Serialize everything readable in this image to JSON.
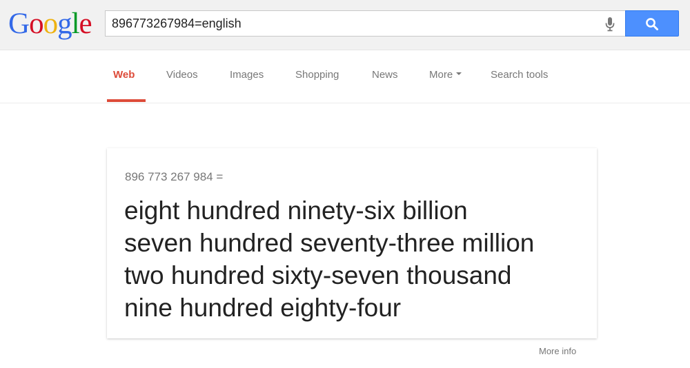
{
  "logo": {
    "letters": [
      {
        "char": "G",
        "color": "#3369e8"
      },
      {
        "char": "o",
        "color": "#d50f25"
      },
      {
        "char": "o",
        "color": "#eeb211"
      },
      {
        "char": "g",
        "color": "#3369e8"
      },
      {
        "char": "l",
        "color": "#009925"
      },
      {
        "char": "e",
        "color": "#d50f25"
      }
    ]
  },
  "search": {
    "query": "896773267984=english",
    "mic_icon": "microphone-icon",
    "button_icon": "magnifier-icon"
  },
  "nav": {
    "tabs": [
      {
        "label": "Web",
        "active": true
      },
      {
        "label": "Videos"
      },
      {
        "label": "Images"
      },
      {
        "label": "Shopping"
      },
      {
        "label": "News"
      },
      {
        "label": "More"
      },
      {
        "label": "Search tools"
      }
    ],
    "active_color": "#dd4b39"
  },
  "result": {
    "expression": "896 773 267 984 =",
    "lines": [
      "eight hundred ninety-six billion",
      "seven hundred seventy-three million",
      "two hundred sixty-seven thousand",
      "nine hundred eighty-four"
    ]
  },
  "footer": {
    "more_info": "More info"
  },
  "colors": {
    "search_button": "#4d90fe",
    "header_bg": "#f1f1f1"
  }
}
